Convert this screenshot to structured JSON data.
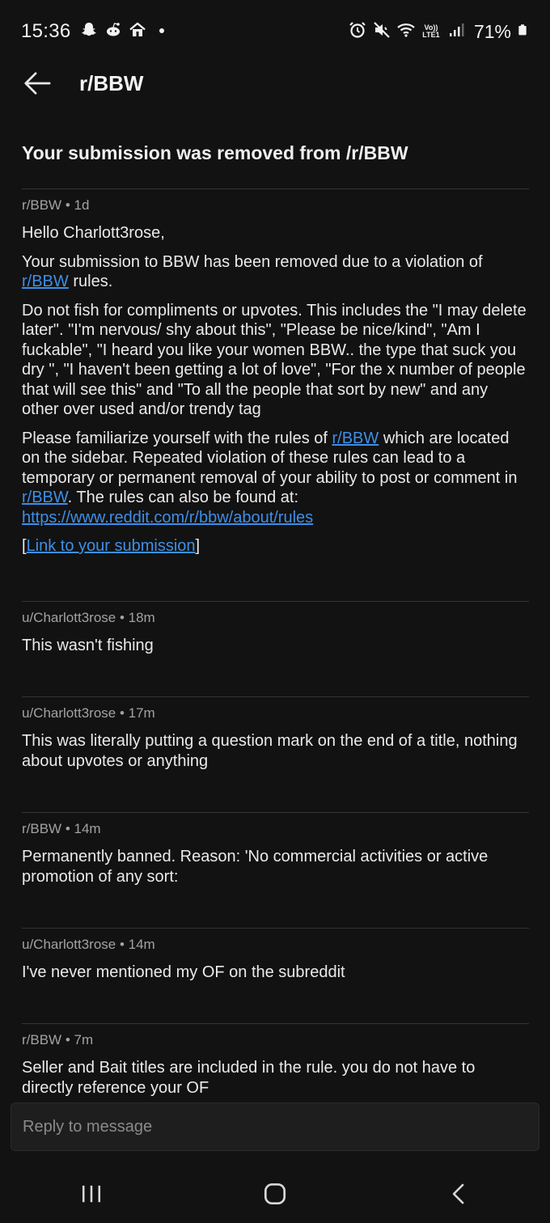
{
  "status_bar": {
    "time": "15:36",
    "left_icons": [
      "snapchat-icon",
      "reddit-icon",
      "home-icon",
      "dot-icon"
    ],
    "right_icons": [
      "alarm-icon",
      "mute-icon",
      "wifi-icon",
      "volte-icon",
      "signal-icon",
      "battery-icon"
    ],
    "volte_label": "Vo)) LTE1",
    "battery": "71%"
  },
  "header": {
    "title": "r/BBW",
    "back_icon": "arrow-left-icon"
  },
  "subject": "Your submission was removed from /r/BBW",
  "messages": [
    {
      "meta": "r/BBW • 1d",
      "greeting": "Hello Charlott3rose,",
      "p1_text": "Your submission to BBW has been removed due to a violation of ",
      "p1_link": "r/BBW",
      "p1_tail": " rules.",
      "p2": "Do not fish for compliments or upvotes. This includes the \"I may delete later\". \"I'm nervous/ shy about this\", \"Please be nice/kind\", \"Am I fuckable\", \"I heard you like your women BBW.. the type that suck you dry \", \"I haven't been getting a lot of love\", \"For the x number of people that will see this\" and \"To all the people that sort by new\" and any other over used and/or trendy tag",
      "p3_a": "Please familiarize yourself with the rules of ",
      "p3_link1": "r/BBW",
      "p3_b": " which are located on the sidebar. Repeated violation of these rules can lead to a temporary or permanent removal of your ability to post or comment in ",
      "p3_link2": "r/BBW",
      "p3_c": ". The rules can also be found at: ",
      "p3_url": "https://www.reddit.com/r/bbw/about/rules",
      "open_bracket": "[",
      "submission_link": "Link to your submission",
      "close_bracket": "]"
    },
    {
      "meta": "u/Charlott3rose • 18m",
      "body": "This wasn't fishing"
    },
    {
      "meta": "u/Charlott3rose • 17m",
      "body": "This was literally putting a question mark on the end of a title, nothing about upvotes or anything"
    },
    {
      "meta": "r/BBW • 14m",
      "body": "Permanently banned. Reason: 'No commercial activities or active promotion of any sort:"
    },
    {
      "meta": "u/Charlott3rose • 14m",
      "body": "I've never mentioned my OF on the subreddit"
    },
    {
      "meta": "r/BBW • 7m",
      "body": "Seller and Bait titles are included in the rule. you do not have to directly reference your OF"
    }
  ],
  "reply": {
    "placeholder": "Reply to message"
  },
  "nav": {
    "icons": [
      "recent-apps-icon",
      "home-button-icon",
      "back-nav-icon"
    ]
  },
  "colors": {
    "background": "#121212",
    "link": "#3d8fe8",
    "divider": "#343434",
    "meta": "#a2a2a2"
  }
}
